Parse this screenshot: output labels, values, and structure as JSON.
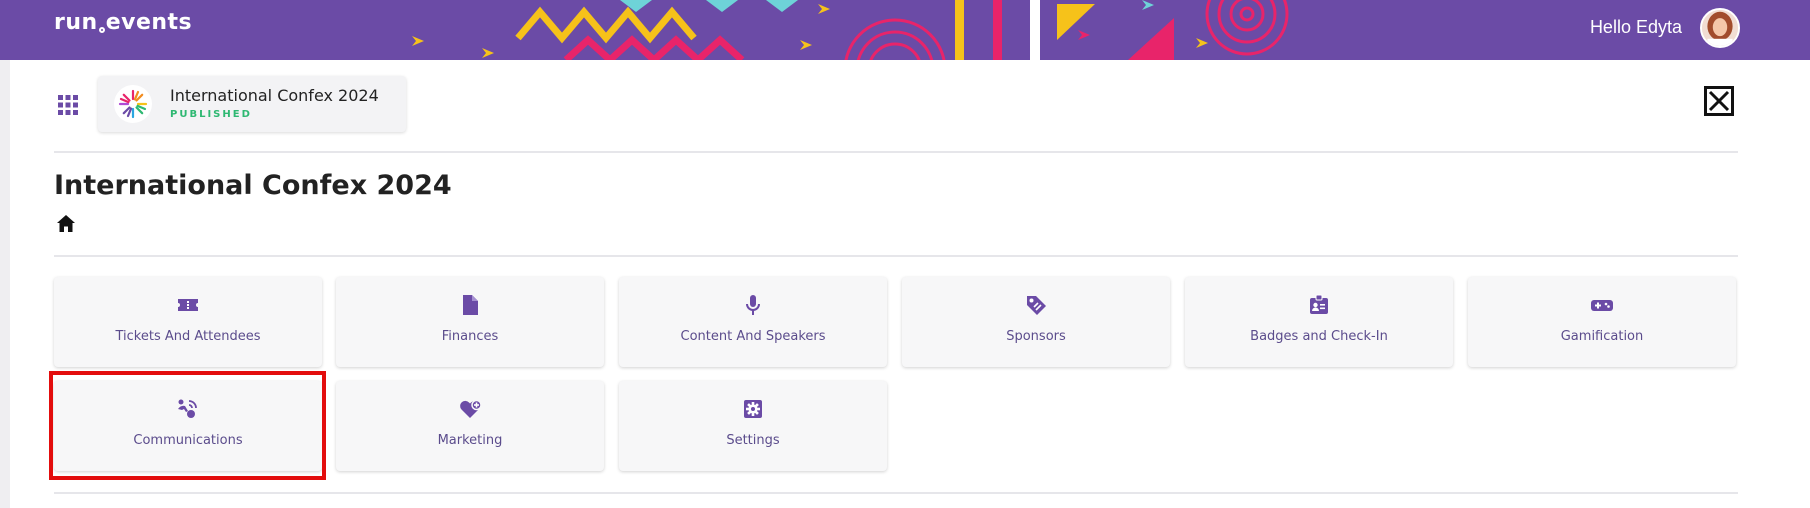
{
  "header": {
    "logo": "run.events",
    "greeting": "Hello Edyta",
    "brand_color": "#6b4ba6"
  },
  "event": {
    "name": "International Confex 2024",
    "status": "PUBLISHED",
    "status_color": "#2eb872"
  },
  "page": {
    "title": "International Confex 2024"
  },
  "tiles": [
    {
      "label": "Tickets And Attendees",
      "icon": "ticket-icon"
    },
    {
      "label": "Finances",
      "icon": "document-icon"
    },
    {
      "label": "Content And Speakers",
      "icon": "microphone-icon"
    },
    {
      "label": "Sponsors",
      "icon": "tag-icon"
    },
    {
      "label": "Badges and Check-In",
      "icon": "id-badge-icon"
    },
    {
      "label": "Gamification",
      "icon": "gamepad-icon"
    },
    {
      "label": "Communications",
      "icon": "broadcast-icon"
    },
    {
      "label": "Marketing",
      "icon": "heart-plus-icon"
    },
    {
      "label": "Settings",
      "icon": "gear-icon"
    }
  ],
  "highlighted_tile": "Communications",
  "colors": {
    "accent": "#6b4ba6",
    "highlight": "#e30d0d",
    "tile_background": "#f7f7f8"
  }
}
